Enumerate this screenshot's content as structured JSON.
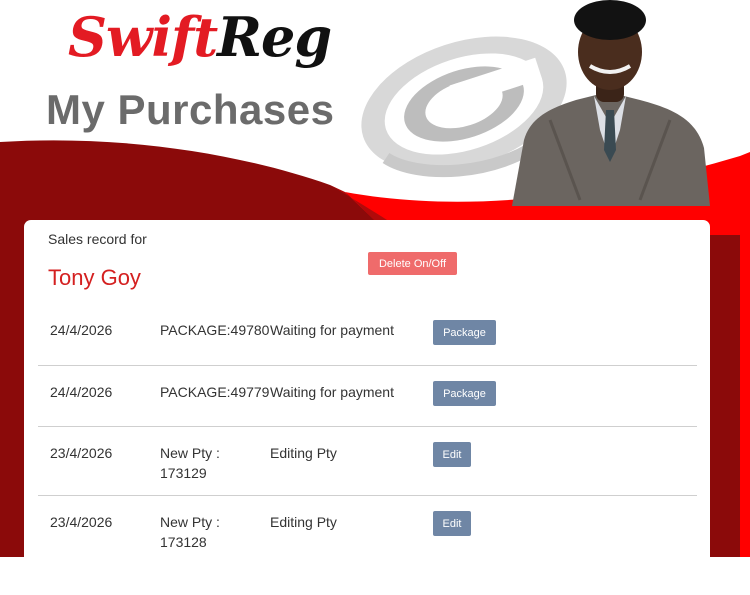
{
  "brand": {
    "part1": "Swift",
    "part2": "Reg"
  },
  "page": {
    "title": "My Purchases"
  },
  "card": {
    "label": "Sales record for",
    "customer_name": "Tony Goy",
    "delete_toggle_label": "Delete On/Off"
  },
  "records": [
    {
      "date": "24/4/2026",
      "reference": "PACKAGE:49780",
      "status": "Waiting for payment",
      "action": "Package"
    },
    {
      "date": "24/4/2026",
      "reference": "PACKAGE:49779",
      "status": "Waiting for payment",
      "action": "Package"
    },
    {
      "date": "23/4/2026",
      "reference": "New Pty :",
      "reference_line2": "173129",
      "status": "Editing Pty",
      "action": "Edit"
    },
    {
      "date": "23/4/2026",
      "reference": "New Pty :",
      "reference_line2": "173128",
      "status": "Editing Pty",
      "action": "Edit"
    }
  ],
  "colors": {
    "brand_red": "#e31b23",
    "dark_red": "#8b0a0a",
    "bright_red": "#ff0000",
    "title_gray": "#6b6b6b",
    "action_button": "#6f86a5",
    "delete_button": "#ef6b6b"
  }
}
